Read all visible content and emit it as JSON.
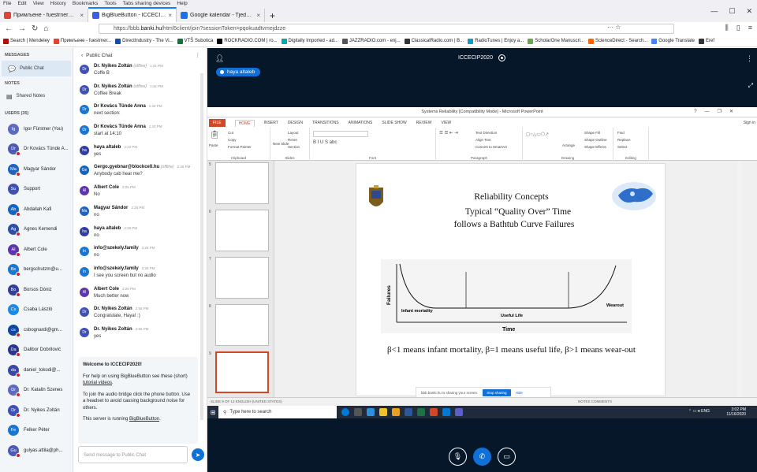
{
  "browser": {
    "menu": [
      "File",
      "Edit",
      "View",
      "History",
      "Bookmarks",
      "Tools",
      "Tabs sharing devices",
      "Help"
    ],
    "tabs": [
      {
        "label": "Примљене - fuestrner@gmail.com",
        "color": "#db4437",
        "active": false
      },
      {
        "label": "BigBlueButton - ICCECIP2020",
        "color": "#3b5fe0",
        "active": true
      },
      {
        "label": "Google kalendar - Tjedan od 16",
        "color": "#1a73e8",
        "active": false
      }
    ],
    "new_tab": "+",
    "url_prefix": "https://bbb.",
    "url_domain": "banki.hu",
    "url_rest": "/html5client/join?sessionToken=pqokuadtvmejdzze",
    "url_dots": "··· ☆",
    "bookmarks": [
      {
        "label": "Search | Mendeley",
        "color": "#a11"
      },
      {
        "label": "Примљене - fuestrner...",
        "color": "#db4437"
      },
      {
        "label": "DirectIndustry - The Vi...",
        "color": "#1a4b9c"
      },
      {
        "label": "VTŠ Subotica",
        "color": "#0a7a3a"
      },
      {
        "label": "ROCKRADIO.COM | ro...",
        "color": "#000"
      },
      {
        "label": "Digitally Imported - ad...",
        "color": "#0aa"
      },
      {
        "label": "JAZZRADIO.com - enj...",
        "color": "#555"
      },
      {
        "label": "ClassicalRadio.com | B...",
        "color": "#333"
      },
      {
        "label": "RadioTunes | Enjoy a...",
        "color": "#19c"
      },
      {
        "label": "ScholarOne Manuscri...",
        "color": "#6a4"
      },
      {
        "label": "ScienceDirect - Search...",
        "color": "#f60"
      },
      {
        "label": "Google Translate",
        "color": "#4285f4"
      },
      {
        "label": "Eref",
        "color": "#333"
      }
    ]
  },
  "leftnav": {
    "messages_header": "MESSAGES",
    "public_chat": "Public Chat",
    "notes_header": "NOTES",
    "shared_notes": "Shared Notes",
    "users_header": "USERS (35)",
    "users": [
      {
        "initials": "Ig",
        "name": "Igor Fürstner (You)",
        "color": "#5c6bc0",
        "dot": false
      },
      {
        "initials": "Dr",
        "name": "Dr Kovács Tünde A...",
        "color": "#4e5bb5",
        "dot": true
      },
      {
        "initials": "Ma",
        "name": "Magyar Sándor",
        "color": "#1e63c3",
        "dot": true
      },
      {
        "initials": "Su",
        "name": "Support",
        "color": "#3f51b5",
        "dot": false
      },
      {
        "initials": "Ab",
        "name": "Abdallah Kafi",
        "color": "#1565c0",
        "dot": true
      },
      {
        "initials": "Ag",
        "name": "Agnes Kemendi",
        "color": "#2e4fa8",
        "dot": true
      },
      {
        "initials": "Al",
        "name": "Albert Cole",
        "color": "#5e35b1",
        "dot": true
      },
      {
        "initials": "Be",
        "name": "bergschutzm@u...",
        "color": "#1976d2",
        "dot": true
      },
      {
        "initials": "Bo",
        "name": "Borsos Dóniz",
        "color": "#303f9f",
        "dot": true
      },
      {
        "initials": "Cs",
        "name": "Csaba László",
        "color": "#1e88e5",
        "dot": false
      },
      {
        "initials": "cs",
        "name": "csbognardi@gm...",
        "color": "#0d47a1",
        "dot": true
      },
      {
        "initials": "Da",
        "name": "Dalibor Dobrilović",
        "color": "#283593",
        "dot": true
      },
      {
        "initials": "da",
        "name": "daniel_tokodi@...",
        "color": "#3949ab",
        "dot": true
      },
      {
        "initials": "Dr",
        "name": "Dr. Katalin Szenes",
        "color": "#5c6bc0",
        "dot": true
      },
      {
        "initials": "Dr",
        "name": "Dr. Nyikes Zoltán",
        "color": "#3f51b5",
        "dot": true
      },
      {
        "initials": "Fe",
        "name": "Felker Péter",
        "color": "#1976d2",
        "dot": false
      },
      {
        "initials": "Gu",
        "name": "gulyas.attila@ph...",
        "color": "#4a5ab8",
        "dot": true
      }
    ]
  },
  "chat": {
    "title": "Public Chat",
    "messages": [
      {
        "initials": "Dr",
        "color": "#3f51b5",
        "name": "Dr. Nyikes Zoltán",
        "status": "(offline)",
        "time": "1:41 PM",
        "text": "Coffe B"
      },
      {
        "initials": "Dr",
        "color": "#3f51b5",
        "name": "Dr. Nyikes Zoltán",
        "status": "(offline)",
        "time": "1:42 PM",
        "text": "Coffee Break"
      },
      {
        "initials": "Dr",
        "color": "#1976d2",
        "name": "Dr Kovács Tünde Anna",
        "status": "",
        "time": "1:42 PM",
        "text": "next section:"
      },
      {
        "initials": "Dr",
        "color": "#1976d2",
        "name": "Dr Kovács Tünde Anna",
        "status": "",
        "time": "1:43 PM",
        "text": "start at 14:10"
      },
      {
        "initials": "ha",
        "color": "#303f9f",
        "name": "haya altaleb",
        "status": "",
        "time": "2:22 PM",
        "text": "yes"
      },
      {
        "initials": "Ge",
        "color": "#1565c0",
        "name": "Gergo.gyebnar@blockcell.hu",
        "status": "(offline)",
        "time": "2:26 PM",
        "text": "Anybody cab hear me?"
      },
      {
        "initials": "Al",
        "color": "#5e35b1",
        "name": "Albert Cole",
        "status": "",
        "time": "2:25 PM",
        "text": "No"
      },
      {
        "initials": "Ma",
        "color": "#1e63c3",
        "name": "Magyar Sándor",
        "status": "",
        "time": "2:25 PM",
        "text": "no"
      },
      {
        "initials": "ha",
        "color": "#303f9f",
        "name": "haya altaleb",
        "status": "",
        "time": "2:26 PM",
        "text": "no"
      },
      {
        "initials": "In",
        "color": "#1976d2",
        "name": "info@szekely.family",
        "status": "",
        "time": "2:26 PM",
        "text": "no"
      },
      {
        "initials": "In",
        "color": "#1976d2",
        "name": "info@szekely.family",
        "status": "",
        "time": "2:26 PM",
        "text": "I see you screen but no audio"
      },
      {
        "initials": "Al",
        "color": "#5e35b1",
        "name": "Albert Cole",
        "status": "",
        "time": "2:26 PM",
        "text": "Much better now"
      },
      {
        "initials": "Dr",
        "color": "#3f51b5",
        "name": "Dr. Nyikes Zoltán",
        "status": "",
        "time": "2:56 PM",
        "text": "Congratulate, Haya! :)"
      },
      {
        "initials": "Dr",
        "color": "#3f51b5",
        "name": "Dr. Nyikes Zoltán",
        "status": "",
        "time": "2:56 PM",
        "text": "yes"
      }
    ],
    "welcome_title": "Welcome to ICCECIP2020!",
    "welcome_p1a": "For help on using BigBlueButton see these (short) ",
    "welcome_p1_link": "tutorial videos",
    "welcome_p2": "To join the audio bridge click the phone button. Use a headset to avoid causing background noise for others.",
    "welcome_p3a": "This server is running ",
    "welcome_p3_link": "BigBlueButton",
    "input_placeholder": "Send message to Public Chat"
  },
  "presentation": {
    "meeting_title": "ICCECIP2020",
    "talker": "haya altaleb",
    "ppt_window_title": "Systems Reliability [Compatibility Mode] - Microsoft PowerPoint",
    "ribbon_tabs": [
      "FILE",
      "HOME",
      "INSERT",
      "DESIGN",
      "TRANSITIONS",
      "ANIMATIONS",
      "SLIDE SHOW",
      "REVIEW",
      "VIEW"
    ],
    "sign_in": "Sign in",
    "ribbon_groups": [
      "Clipboard",
      "Slides",
      "Font",
      "Paragraph",
      "Drawing",
      "Editing"
    ],
    "ribbon_items": {
      "paste": "Paste",
      "cut": "Cut",
      "copy": "Copy",
      "format_painter": "Format Painter",
      "new_slide": "New Slide",
      "layout": "Layout",
      "reset": "Reset",
      "section": "Section",
      "text_direction": "Text Direction",
      "align_text": "Align Text",
      "smartart": "Convert to SmartArt",
      "arrange": "Arrange",
      "quick_styles": "Quick Styles",
      "shape_fill": "Shape Fill",
      "shape_outline": "Shape Outline",
      "shape_effects": "Shape Effects",
      "find": "Find",
      "replace": "Replace",
      "select": "Select"
    },
    "slide_numbers": [
      "5",
      "6",
      "7",
      "8",
      "9"
    ],
    "slide_title": "Reliability Concepts",
    "slide_subtitle1": "Typical “Quality Over” Time",
    "slide_subtitle2": "follows a Bathtub Curve Failures",
    "curve_labels": {
      "y": "Failures",
      "x": "Time",
      "infant": "Infant mortality",
      "useful": "Useful Life",
      "wearout": "Wearout"
    },
    "slide_footer": "β<1 means infant mortality, β=1 means useful life, β>1 means wear-out",
    "share_notice": "bbb.banki.hu is sharing your screen.",
    "stop_sharing": "Stop sharing",
    "hide": "Hide",
    "statusbar": "SLIDE 9 OF 14    ENGLISH (UNITED STATES)",
    "notes_comments": "NOTES    COMMENTS",
    "taskbar_search": "Type here to search",
    "lang": "ENG",
    "time": "3:02 PM",
    "date": "11/16/2020"
  },
  "controls": {
    "mute": "mute-icon",
    "audio": "phone-icon",
    "share": "screen-share-icon"
  }
}
